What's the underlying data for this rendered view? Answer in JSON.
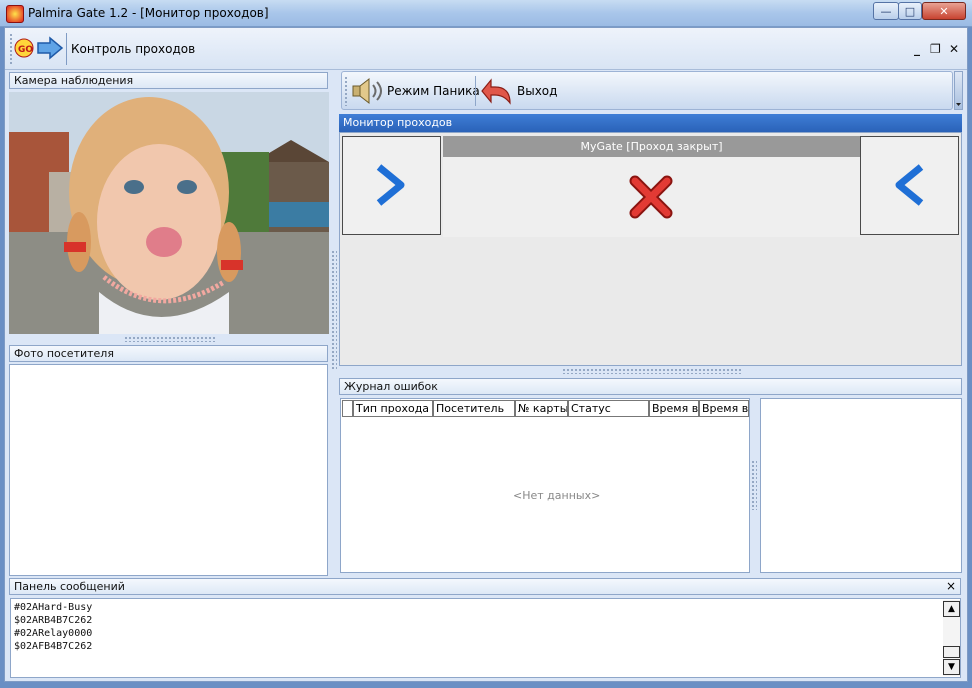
{
  "window": {
    "title": "Palmira Gate 1.2 - [Монитор проходов]",
    "minimize": "—",
    "maximize": "□",
    "close": "✕"
  },
  "docbar": {
    "label": "Контроль проходов",
    "mdi_min": "_",
    "mdi_restore": "❐",
    "mdi_close": "✕"
  },
  "camera": {
    "title": "Камера наблюдения"
  },
  "visitor_photo": {
    "title": "Фото посетителя"
  },
  "toolbar": {
    "panic_label": "Режим Паника",
    "exit_label": "Выход"
  },
  "monitor": {
    "title": "Монитор проходов",
    "gate_status": "MyGate [Проход закрыт]"
  },
  "errors": {
    "title": "Журнал ошибок",
    "columns": [
      "Тип прохода",
      "Посетитель",
      "№ карты",
      "Статус",
      "Время вх",
      "Время вы"
    ],
    "empty_text": "<Нет данных>"
  },
  "messages": {
    "title": "Панель сообщений",
    "close": "×",
    "lines": [
      "#02AHard-Busy",
      "$02ARB4B7C262",
      "#02ARelay0000",
      "$02AFB4B7C262"
    ]
  },
  "colors": {
    "accent": "#2a62b8",
    "gate_bar": "#999999",
    "deny": "#d22a2a"
  }
}
